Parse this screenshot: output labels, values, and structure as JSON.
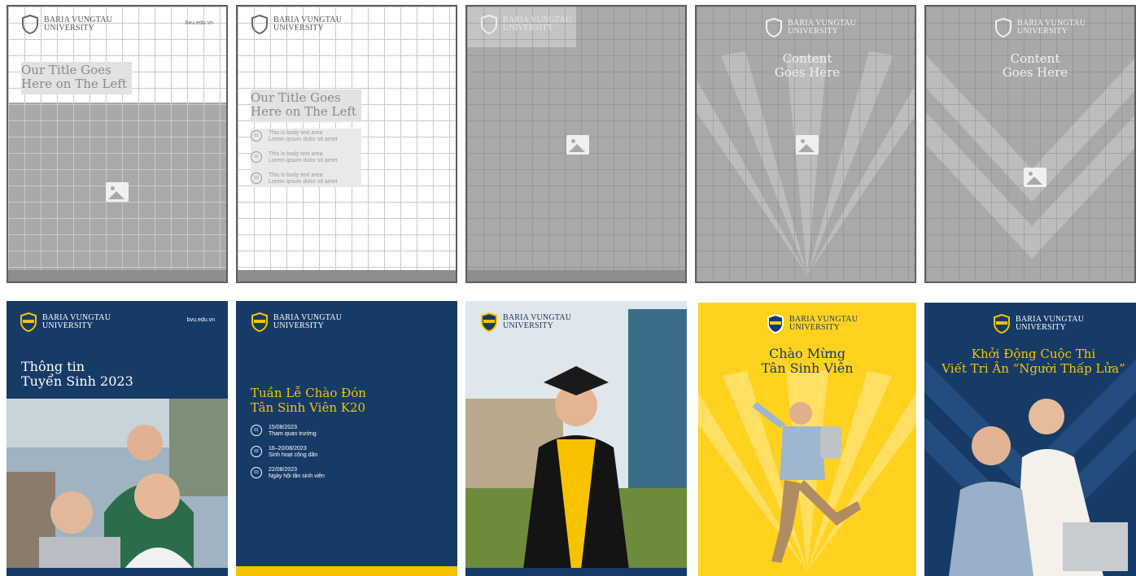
{
  "brand": {
    "logo_line1": "BARIA VUNGTAU",
    "logo_line2": "UNIVERSITY",
    "shield_text": "BVU",
    "domain": "bvu.edu.vn",
    "colors": {
      "navy": "#163b67",
      "gold": "#f7c300",
      "yellow": "#ffd21f",
      "wire_gray": "#a9a9a9"
    }
  },
  "templates": [
    {
      "title_line1": "Our Title Goes",
      "title_line2": "Here on The Left"
    },
    {
      "title_line1": "Our Title Goes",
      "title_line2": "Here on The Left",
      "items": [
        {
          "num": "01",
          "line1": "This is body text area",
          "line2": "Lorem ipsum dolor sit amet"
        },
        {
          "num": "02",
          "line1": "This is body text area",
          "line2": "Lorem ipsum dolor sit amet"
        },
        {
          "num": "03",
          "line1": "This is body text area",
          "line2": "Lorem ipsum dolor sit amet"
        }
      ]
    },
    {},
    {
      "title_line1": "Content",
      "title_line2": "Goes Here"
    },
    {
      "title_line1": "Content",
      "title_line2": "Goes Here"
    }
  ],
  "posters": [
    {
      "title_line1": "Thông tin",
      "title_line2": "Tuyển Sinh 2023"
    },
    {
      "title_line1": "Tuần Lễ Chào Đón",
      "title_line2": "Tân Sinh Viên K20",
      "items": [
        {
          "num": "01",
          "line1": "15/08/2023",
          "line2": "Tham quan trường"
        },
        {
          "num": "02",
          "line1": "16–20/08/2023",
          "line2": "Sinh hoạt công dân"
        },
        {
          "num": "03",
          "line1": "22/08/2023",
          "line2": "Ngày hội tân sinh viên"
        }
      ]
    },
    {},
    {
      "title_line1": "Chào Mừng",
      "title_line2": "Tân Sinh Viên"
    },
    {
      "title_line1": "Khởi Động Cuộc Thi",
      "title_line2": "Viết Tri Ân “Người Thấp Lửa”"
    }
  ]
}
